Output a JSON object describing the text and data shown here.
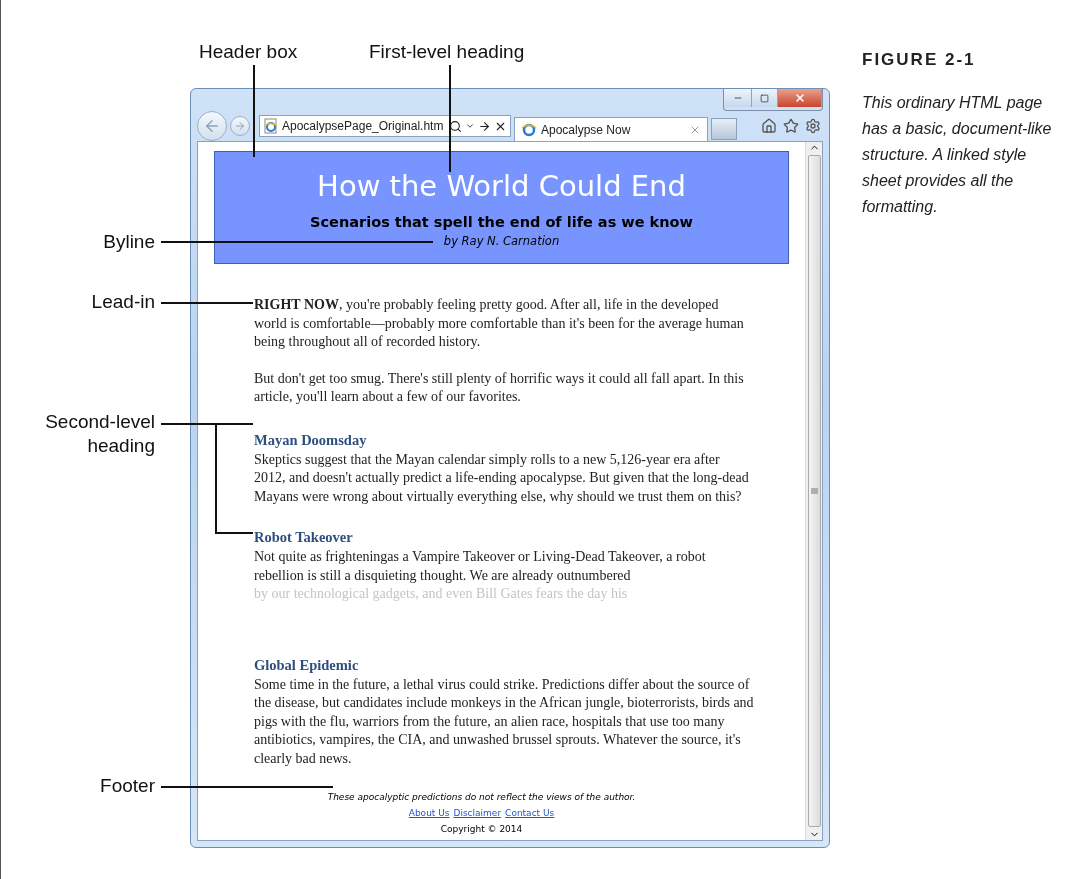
{
  "callouts": [
    {
      "label": "Header box",
      "kind": "down"
    },
    {
      "label": "First-level heading",
      "kind": "down"
    },
    {
      "label": "Byline",
      "kind": "left"
    },
    {
      "label": "Lead-in",
      "kind": "left"
    },
    {
      "label": "Second-level heading",
      "kind": "bracket"
    },
    {
      "label": "Footer",
      "kind": "left"
    }
  ],
  "figure": {
    "number": "FIGURE 2-1",
    "caption": "This ordinary HTML page has a basic, document-like structure. A linked style sheet provides all the formatting."
  },
  "browser": {
    "address": "ApocalypsePage_Original.htm",
    "tab": "Apocalypse Now"
  },
  "page": {
    "header": {
      "title": "How the World Could End",
      "subtitle": "Scenarios that spell the end of life as we know",
      "byline": "by Ray N. Carnation"
    },
    "intro": [
      "**RIGHT NOW**, you're probably feeling pretty good. After all, life in the developed world is comfortable—probably more comfortable than it's been for the average human being throughout all of recorded history.",
      "But don't get too smug. There's still plenty of horrific ways it could all fall apart. In this article, you'll learn about a few of our favorites."
    ],
    "sections": [
      {
        "heading": "Mayan Doomsday",
        "body": "Skeptics suggest that the Mayan calendar simply rolls to a new 5,126-year era after 2012, and doesn't actually predict a life-ending apocalypse. But given that the long-dead Mayans were wrong about virtually everything else, why should we trust them on this?"
      },
      {
        "heading": "Robot Takeover",
        "body": "Not quite as frighteningas a Vampire Takeover or Living-Dead Takeover, a robot rebellion is still a disquieting thought. We are already outnumbered",
        "faded_line": "by our technological gadgets, and even Bill Gates fears the day his"
      },
      {
        "heading": "Global Epidemic",
        "body": "Some time in the future, a lethal virus could strike. Predictions differ about the source of the disease, but candidates include monkeys in the African jungle, bioterrorists, birds and pigs with the flu, warriors from the future, an alien race, hospitals that use too many antibiotics, vampires, the CIA, and unwashed brussel sprouts. Whatever the source, it's clearly bad news."
      }
    ],
    "footer": {
      "note": "These apocalyptic predictions do not reflect the views of the author.",
      "links": [
        "About Us",
        "Disclaimer",
        "Contact Us"
      ],
      "copyright": "Copyright © 2014"
    }
  }
}
